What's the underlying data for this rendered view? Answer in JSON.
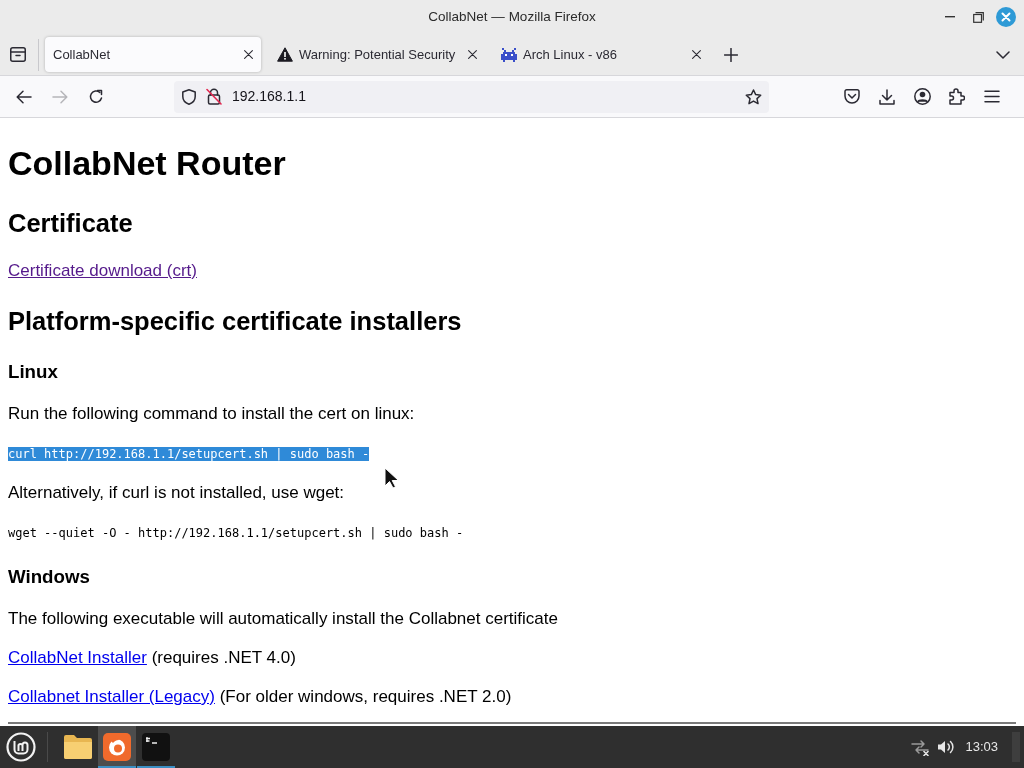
{
  "window": {
    "title": "CollabNet — Mozilla Firefox"
  },
  "tabs": [
    {
      "label": "CollabNet",
      "selected": true,
      "kind": "plain"
    },
    {
      "label": "Warning: Potential Security",
      "selected": false,
      "kind": "warning"
    },
    {
      "label": "Arch Linux - v86",
      "selected": false,
      "kind": "app"
    }
  ],
  "nav_buttons": [
    {
      "kind": "back",
      "disabled": false
    },
    {
      "kind": "forward",
      "disabled": true
    },
    {
      "kind": "reload",
      "disabled": false
    }
  ],
  "address_bar": {
    "url": "192.168.1.1"
  },
  "page": {
    "blocks": [
      {
        "kind": "h1",
        "text": "CollabNet Router"
      },
      {
        "kind": "h2",
        "text": "Certificate"
      },
      {
        "kind": "link",
        "text": "Certificate download (crt)",
        "visited": true
      },
      {
        "kind": "h2",
        "text": "Platform-specific certificate installers"
      },
      {
        "kind": "h3",
        "text": "Linux"
      },
      {
        "kind": "p",
        "text": "Run the following command to install the cert on linux:"
      },
      {
        "kind": "code",
        "text": "curl http://192.168.1.1/setupcert.sh | sudo bash -",
        "selected": true
      },
      {
        "kind": "p",
        "text": "Alternatively, if curl is not installed, use wget:"
      },
      {
        "kind": "code",
        "text": "wget --quiet -O - http://192.168.1.1/setupcert.sh | sudo bash -",
        "selected": false
      },
      {
        "kind": "h3",
        "text": "Windows"
      },
      {
        "kind": "p",
        "text": "The following executable will automatically install the Collabnet certificate"
      },
      {
        "kind": "link",
        "text": "CollabNet Installer",
        "note": "(requires .NET 4.0)",
        "visited": false
      },
      {
        "kind": "link",
        "text": "Collabnet Installer (Legacy)",
        "note": "(For older windows, requires .NET 2.0)",
        "visited": false
      },
      {
        "kind": "rule"
      }
    ]
  },
  "taskbar": {
    "apps": [
      {
        "kind": "files",
        "active": false,
        "running": false
      },
      {
        "kind": "browser",
        "active": true,
        "running": true
      },
      {
        "kind": "terminal",
        "active": false,
        "running": true
      }
    ],
    "network_connected": false,
    "clock": "13:03"
  }
}
